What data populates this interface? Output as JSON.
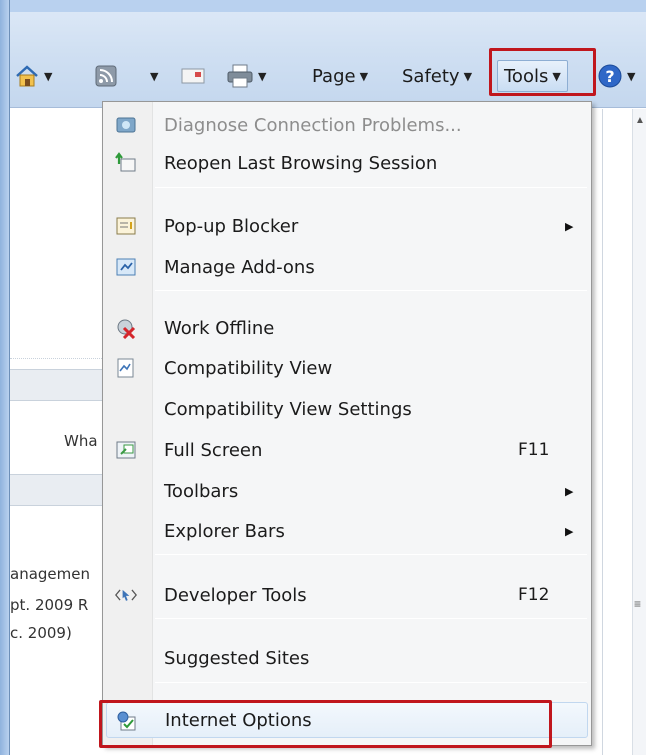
{
  "toolbar": {
    "page_label": "Page",
    "safety_label": "Safety",
    "tools_label": "Tools"
  },
  "page_content": {
    "text_what": "Wha",
    "text_management": "anagemen",
    "text_sept": "pt. 2009 R",
    "text_dec": "c. 2009)",
    "scroll_mark": "≡"
  },
  "menu": {
    "items": [
      {
        "label": "Diagnose Connection Problems...",
        "icon": "diagnose-icon",
        "disabled": true
      },
      {
        "label": "Reopen Last Browsing Session",
        "icon": "reopen-session-icon"
      },
      {
        "label": "Pop-up Blocker",
        "icon": "popup-blocker-icon",
        "submenu": true
      },
      {
        "label": "Manage Add-ons",
        "icon": "addons-icon"
      },
      {
        "label": "Work Offline",
        "icon": "work-offline-icon"
      },
      {
        "label": "Compatibility View",
        "icon": "compatibility-view-icon"
      },
      {
        "label": "Compatibility View Settings",
        "icon": ""
      },
      {
        "label": "Full Screen",
        "icon": "full-screen-icon",
        "shortcut": "F11"
      },
      {
        "label": "Toolbars",
        "icon": "",
        "submenu": true
      },
      {
        "label": "Explorer Bars",
        "icon": "",
        "submenu": true
      },
      {
        "label": "Developer Tools",
        "icon": "developer-tools-icon",
        "shortcut": "F12"
      },
      {
        "label": "Suggested Sites",
        "icon": ""
      },
      {
        "label": "Internet Options",
        "icon": "internet-options-icon"
      }
    ],
    "submenu_arrow": "▶"
  },
  "colors": {
    "highlight_red": "#c0161d",
    "toolbar_bg": "#cfdff2",
    "menu_bg": "#f5f6f7"
  }
}
